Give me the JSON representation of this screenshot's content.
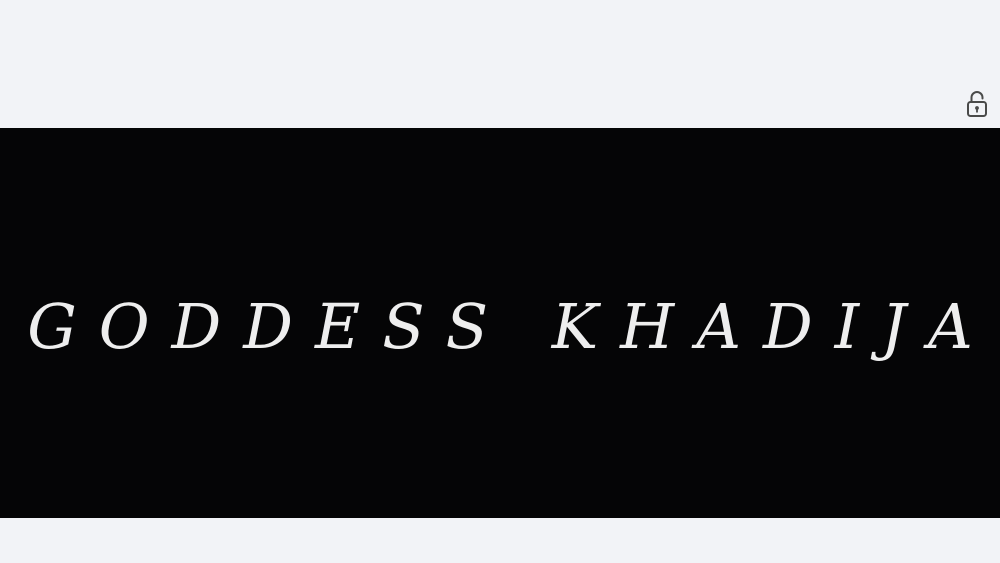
{
  "header": {
    "lock_icon": "unlocked-padlock-icon"
  },
  "banner": {
    "title": "GODDESS KHADIJA",
    "background_color": "#050506",
    "text_color": "#eeeeee"
  },
  "page": {
    "background_color": "#f2f3f7"
  }
}
